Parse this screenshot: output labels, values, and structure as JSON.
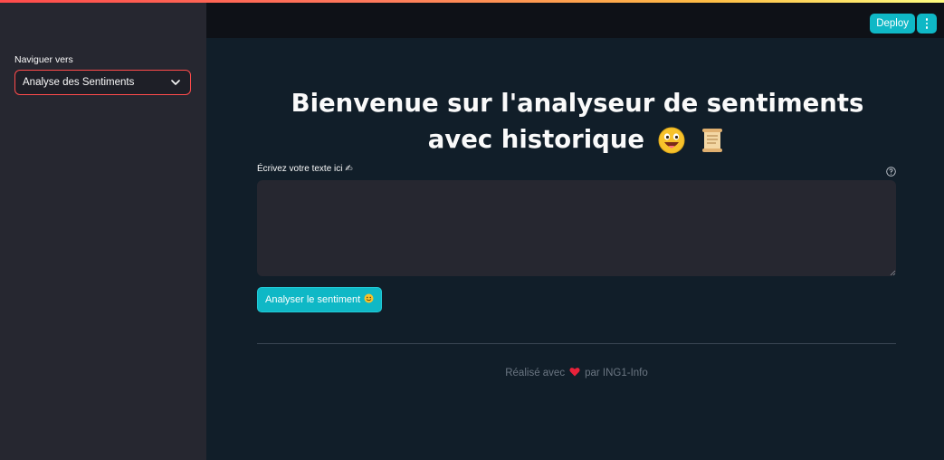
{
  "colors": {
    "accent": "#0fb8c6",
    "select_border": "#ff4b4b",
    "heart": "#e8223a"
  },
  "sidebar": {
    "nav_label": "Naviguer vers",
    "nav_selected": "Analyse des Sentiments"
  },
  "header": {
    "deploy_label": "Deploy"
  },
  "main": {
    "title": "Bienvenue sur l'analyseur de sentiments avec historique",
    "title_emojis": [
      "grinning-face-icon",
      "scroll-icon"
    ],
    "field_label": "Écrivez votre texte ici",
    "field_label_icon": "writing-hand-icon",
    "field_value": "",
    "analyze_label": "Analyser le sentiment",
    "analyze_icon": "smiling-face-icon",
    "footer_before": "Réalisé avec",
    "footer_after": "par ING1-Info"
  }
}
